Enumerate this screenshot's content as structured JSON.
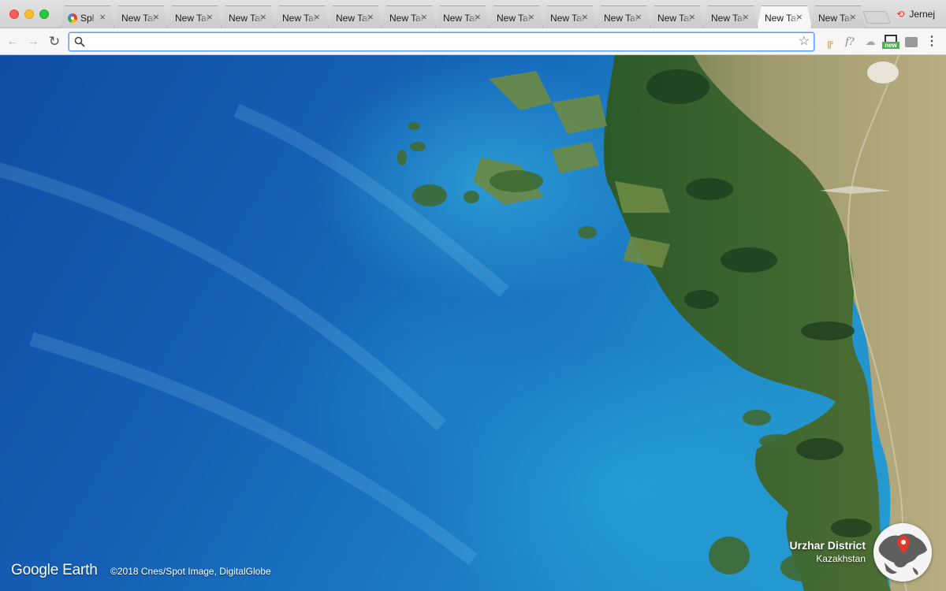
{
  "browser": {
    "tabs": [
      {
        "title": "Spl",
        "has_favicon": true,
        "active": false
      },
      {
        "title": "New Tab",
        "active": false
      },
      {
        "title": "New Tab",
        "active": false
      },
      {
        "title": "New Tab",
        "active": false
      },
      {
        "title": "New Tab",
        "active": false
      },
      {
        "title": "New Tab",
        "active": false
      },
      {
        "title": "New Tab",
        "active": false
      },
      {
        "title": "New Tab",
        "active": false
      },
      {
        "title": "New Tab",
        "active": false
      },
      {
        "title": "New Tab",
        "active": false
      },
      {
        "title": "New Tab",
        "active": false
      },
      {
        "title": "New Tab",
        "active": false
      },
      {
        "title": "New Tab",
        "active": false
      },
      {
        "title": "New Tab",
        "active": true
      },
      {
        "title": "New Tab",
        "active": false
      }
    ],
    "tab_close_glyph": "×",
    "profile_name": "Jernej",
    "omnibox": {
      "value": "",
      "placeholder": ""
    },
    "extensions": {
      "e2_label": "f?",
      "e4_badge": "new"
    },
    "icons": [
      "back-icon",
      "forward-icon",
      "reload-icon",
      "search-icon",
      "star-icon",
      "menu-icon",
      "sync-error-icon"
    ]
  },
  "earth": {
    "logo": "Google Earth",
    "copyright": "©2018 Cnes/Spot Image, DigitalGlobe",
    "location": {
      "name": "Urzhar District",
      "country": "Kazakhstan"
    }
  },
  "colors": {
    "water_deep": "#0f4ea5",
    "water_shallow": "#27a0d4",
    "land_green": "#2f5a2a",
    "land_steppe": "#a9a173",
    "omnibox_focus": "#5a9cf8",
    "pin_red": "#e2372b"
  }
}
